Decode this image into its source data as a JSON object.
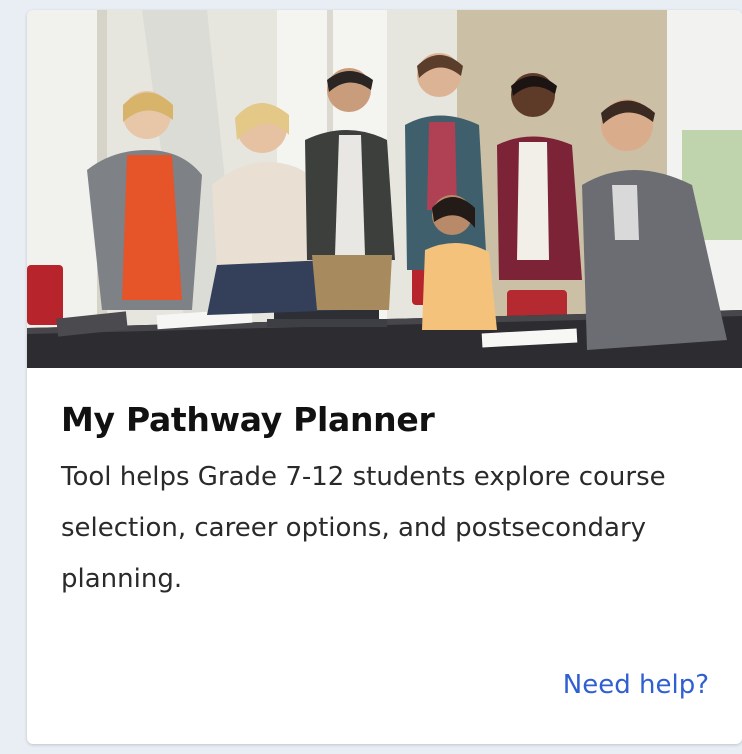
{
  "card": {
    "title": "My Pathway Planner",
    "description": "Tool helps Grade 7-12 students explore course selection, career options, and postsecondary planning.",
    "help_link": "Need help?"
  },
  "colors": {
    "page_background": "#e9eef5",
    "card_background": "#ffffff",
    "title": "#111111",
    "description": "#2a2a2a",
    "link": "#2f5fd0"
  }
}
